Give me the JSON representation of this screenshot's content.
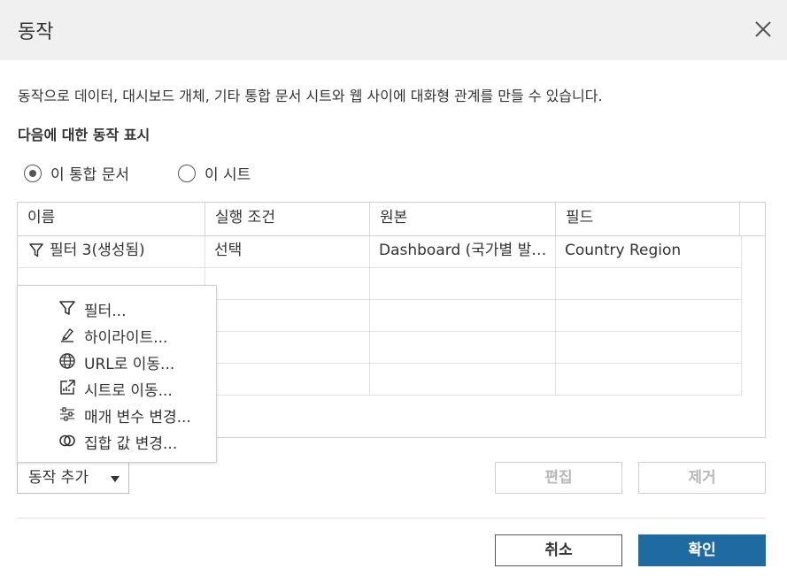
{
  "dialog": {
    "title": "동작",
    "description": "동작으로 데이터, 대시보드 개체, 기타 통합 문서 시트와 웹 사이에 대화형 관계를 만들 수 있습니다.",
    "show_actions_for_label": "다음에 대한 동작 표시",
    "scope_options": [
      {
        "label": "이 통합 문서",
        "selected": true
      },
      {
        "label": "이 시트",
        "selected": false
      }
    ]
  },
  "table": {
    "columns": [
      "이름",
      "실행 조건",
      "원본",
      "필드"
    ],
    "rows": [
      {
        "icon": "filter-icon",
        "name": "필터 3(생성됨)",
        "run_on": "선택",
        "source": "Dashboard (국가별 발…",
        "field": "Country Region"
      }
    ]
  },
  "add_action_menu": {
    "items": [
      {
        "icon": "filter-icon",
        "label": "필터..."
      },
      {
        "icon": "highlight-pen-icon",
        "label": "하이라이트..."
      },
      {
        "icon": "globe-icon",
        "label": "URL로 이동..."
      },
      {
        "icon": "sheet-link-icon",
        "label": "시트로 이동..."
      },
      {
        "icon": "sliders-icon",
        "label": "매개 변수 변경..."
      },
      {
        "icon": "set-rings-icon",
        "label": "집합 값 변경..."
      }
    ],
    "highlight_color": "#ffff26"
  },
  "buttons": {
    "add_action": "동작 추가",
    "edit": "편집",
    "remove": "제거",
    "cancel": "취소",
    "ok": "확인"
  },
  "colors": {
    "primary": "#1f6aa0",
    "title_bar": "#f0f0f0",
    "disabled_text": "#b8b8b8"
  }
}
